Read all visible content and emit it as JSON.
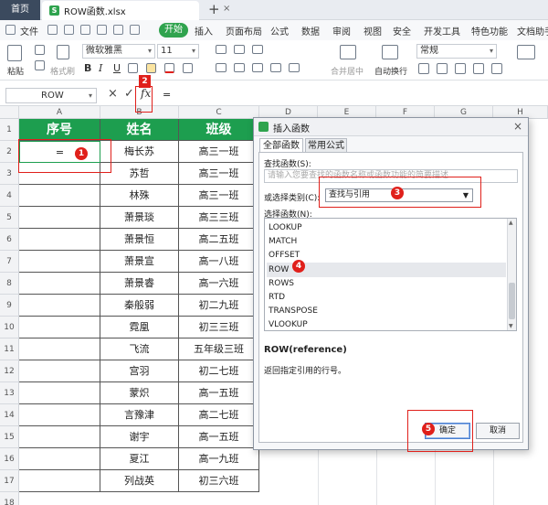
{
  "tabs": {
    "home": "首页",
    "file": "ROW函数.xlsx",
    "close": "×",
    "add": "+"
  },
  "menu": {
    "file": "文件",
    "start": "开始",
    "items": [
      "插入",
      "页面布局",
      "公式",
      "数据",
      "审阅",
      "视图",
      "安全",
      "开发工具",
      "特色功能",
      "文档助手"
    ]
  },
  "ribbon": {
    "paste": "粘贴",
    "format_painter": "格式刷",
    "font_name": "微软雅黑",
    "font_size": "11",
    "merge": "合并居中",
    "wrap": "自动换行",
    "number_format": "常规",
    "bold": "B",
    "italic": "I",
    "underline": "U"
  },
  "formula_bar": {
    "name_box": "ROW",
    "cancel": "×",
    "confirm": "✓",
    "fx": "fx",
    "formula": "="
  },
  "columns": [
    "A",
    "B",
    "C",
    "D",
    "E",
    "F",
    "G",
    "H"
  ],
  "rows": [
    "1",
    "2",
    "3",
    "4",
    "5",
    "6",
    "7",
    "8",
    "9",
    "10",
    "11",
    "12",
    "13",
    "14",
    "15",
    "16",
    "17",
    "18"
  ],
  "sheet": {
    "headers": [
      "序号",
      "姓名",
      "班级"
    ],
    "a2": "=",
    "data": [
      [
        "梅长苏",
        "高三一班"
      ],
      [
        "苏哲",
        "高三一班"
      ],
      [
        "林殊",
        "高三一班"
      ],
      [
        "萧景琰",
        "高三三班"
      ],
      [
        "萧景恒",
        "高二五班"
      ],
      [
        "萧景宣",
        "高一八班"
      ],
      [
        "萧景睿",
        "高一六班"
      ],
      [
        "秦般弱",
        "初二九班"
      ],
      [
        "霓凰",
        "初三三班"
      ],
      [
        "飞流",
        "五年级三班"
      ],
      [
        "宫羽",
        "初二七班"
      ],
      [
        "蒙炽",
        "高一五班"
      ],
      [
        "言豫津",
        "高二七班"
      ],
      [
        "谢宇",
        "高一五班"
      ],
      [
        "夏江",
        "高一九班"
      ],
      [
        "列战英",
        "初三六班"
      ]
    ]
  },
  "dialog": {
    "title": "插入函数",
    "close": "×",
    "tabs": [
      "全部函数",
      "常用公式"
    ],
    "search_label": "查找函数(S):",
    "search_placeholder": "请输入您要查找的函数名称或函数功能的简要描述",
    "category_label": "或选择类别(C):",
    "category_value": "查找与引用",
    "function_label": "选择函数(N):",
    "functions": [
      "LOOKUP",
      "MATCH",
      "OFFSET",
      "ROW",
      "ROWS",
      "RTD",
      "TRANSPOSE",
      "VLOOKUP"
    ],
    "selected_function": "ROW",
    "signature": "ROW(reference)",
    "description": "返回指定引用的行号。",
    "ok": "确定",
    "cancel": "取消"
  },
  "annotations": [
    "1",
    "2",
    "3",
    "4",
    "5"
  ],
  "colors": {
    "header_green": "#1d9e4f",
    "annotation_red": "#e0201b",
    "brand_green": "#2fa34e"
  }
}
